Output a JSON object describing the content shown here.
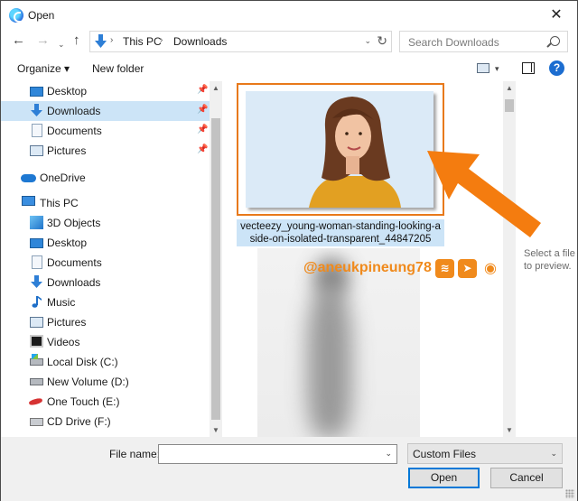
{
  "window": {
    "title": "Open",
    "close_glyph": "✕"
  },
  "address": {
    "path": [
      "This PC",
      "Downloads"
    ],
    "search_placeholder": "Search Downloads"
  },
  "toolbar": {
    "organize": "Organize ▾",
    "new_folder": "New folder",
    "help": "?"
  },
  "sidebar": {
    "quick_access": [
      {
        "label": "Desktop",
        "icon": "desktop-icon",
        "pinned": true
      },
      {
        "label": "Downloads",
        "icon": "download-icon",
        "pinned": true,
        "selected": true
      },
      {
        "label": "Documents",
        "icon": "documents-icon",
        "pinned": true
      },
      {
        "label": "Pictures",
        "icon": "pictures-icon",
        "pinned": true
      }
    ],
    "onedrive": "OneDrive",
    "this_pc": "This PC",
    "this_pc_items": [
      {
        "label": "3D Objects",
        "icon": "3d-objects-icon"
      },
      {
        "label": "Desktop",
        "icon": "desktop-icon"
      },
      {
        "label": "Documents",
        "icon": "documents-icon"
      },
      {
        "label": "Downloads",
        "icon": "download-icon"
      },
      {
        "label": "Music",
        "icon": "music-icon"
      },
      {
        "label": "Pictures",
        "icon": "pictures-icon"
      },
      {
        "label": "Videos",
        "icon": "videos-icon"
      },
      {
        "label": "Local Disk (C:)",
        "icon": "local-disk-icon"
      },
      {
        "label": "New Volume (D:)",
        "icon": "drive-icon"
      },
      {
        "label": "One Touch (E:)",
        "icon": "external-drive-icon"
      },
      {
        "label": "CD Drive (F:)",
        "icon": "cd-drive-icon"
      }
    ]
  },
  "files": [
    {
      "name": "vecteezy_young-woman-standing-looking-a side-on-isolated-transparent_44847205",
      "line1": "vecteezy_young-woman-standing-looking-a",
      "line2": "side-on-isolated-transparent_44847205",
      "selected": true
    }
  ],
  "watermark": {
    "text": "@aneukpineung78",
    "icons": [
      "steemit-icon",
      "telegram-icon",
      "discord-icon"
    ]
  },
  "preview": {
    "text": "Select a file to preview."
  },
  "footer": {
    "file_name_label": "File name:",
    "file_name_value": "",
    "file_type": "Custom Files",
    "open": "Open",
    "cancel": "Cancel"
  },
  "colors": {
    "accent": "#0078d7",
    "selection": "#cce4f7",
    "annotation": "#f08a1c"
  }
}
